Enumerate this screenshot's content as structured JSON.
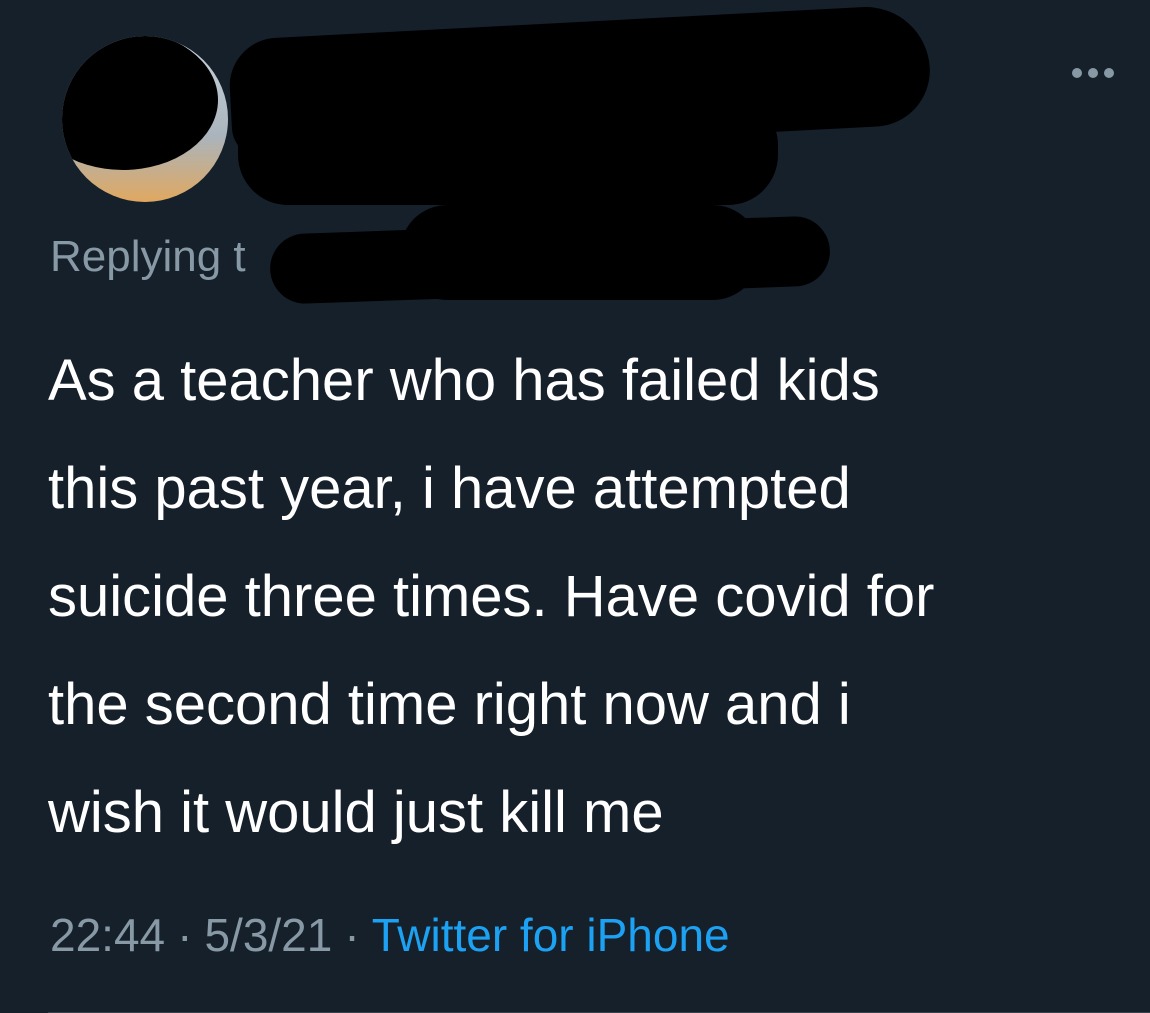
{
  "tweet": {
    "replying_prefix": "Replying t",
    "text_lines": [
      "As a teacher who has failed kids",
      "this past year, i have attempted",
      "suicide three times. Have covid for",
      "the second time right now and i",
      "wish it would just kill me"
    ],
    "time": "22:44",
    "date": "5/3/21",
    "source": "Twitter for iPhone",
    "separator": "·"
  },
  "colors": {
    "background": "#15202b",
    "text": "#ffffff",
    "muted": "#8899a6",
    "link": "#1da1f2"
  },
  "icons": {
    "more": "more-icon"
  }
}
